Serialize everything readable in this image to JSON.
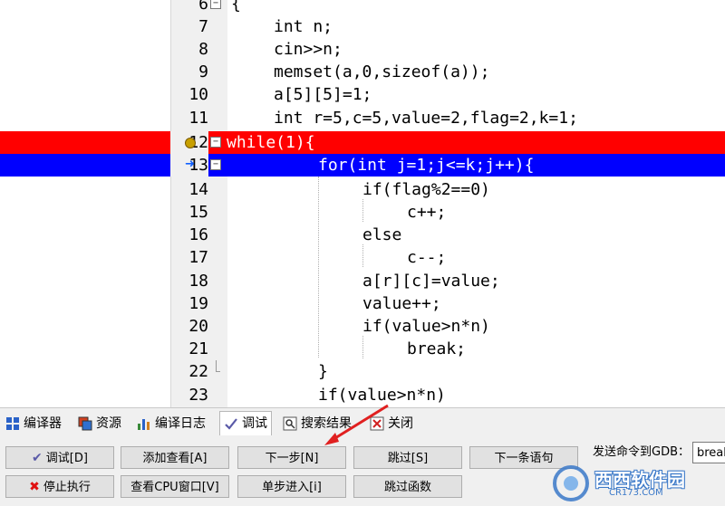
{
  "editor": {
    "lines": [
      {
        "num": "6",
        "text": "{"
      },
      {
        "num": "7",
        "text": "int n;"
      },
      {
        "num": "8",
        "text": "cin>>n;"
      },
      {
        "num": "9",
        "text": "memset(a,0,sizeof(a));"
      },
      {
        "num": "10",
        "text": "a[5][5]=1;"
      },
      {
        "num": "11",
        "text": "int r=5,c=5,value=2,flag=2,k=1;"
      },
      {
        "num": "12",
        "text": "while(1){"
      },
      {
        "num": "13",
        "text": "for(int j=1;j<=k;j++){"
      },
      {
        "num": "14",
        "text": "if(flag%2==0)"
      },
      {
        "num": "15",
        "text": "c++;"
      },
      {
        "num": "16",
        "text": "else"
      },
      {
        "num": "17",
        "text": "c--;"
      },
      {
        "num": "18",
        "text": "a[r][c]=value;"
      },
      {
        "num": "19",
        "text": "value++;"
      },
      {
        "num": "20",
        "text": "if(value>n*n)"
      },
      {
        "num": "21",
        "text": "break;"
      },
      {
        "num": "22",
        "text": "}"
      },
      {
        "num": "23",
        "text": "if(value>n*n)"
      }
    ],
    "breakpoint_line": "12",
    "current_line": "13",
    "breakpoint_color": "#ff0000",
    "current_color": "#0000ff"
  },
  "tabs": [
    {
      "label": "编译器",
      "icon": "compiler-grid-icon"
    },
    {
      "label": "资源",
      "icon": "resources-icon"
    },
    {
      "label": "编译日志",
      "icon": "bar-chart-icon"
    },
    {
      "label": "调试",
      "icon": "check-icon",
      "active": true
    },
    {
      "label": "搜索结果",
      "icon": "search-results-icon"
    },
    {
      "label": "关闭",
      "icon": "close-tab-icon"
    }
  ],
  "toolbar": {
    "debug": "调试[D]",
    "add_watch": "添加查看[A]",
    "next_step": "下一步[N]",
    "skip": "跳过[S]",
    "next_statement": "下一条语句",
    "stop": "停止执行",
    "cpu_window": "查看CPU窗口[V]",
    "step_into": "单步进入[i]",
    "skip_function": "跳过函数",
    "gdb_label": "发送命令到GDB：",
    "gdb_value": "break"
  },
  "watermark": {
    "text": "西西软件园",
    "sub": "CR173.COM"
  }
}
